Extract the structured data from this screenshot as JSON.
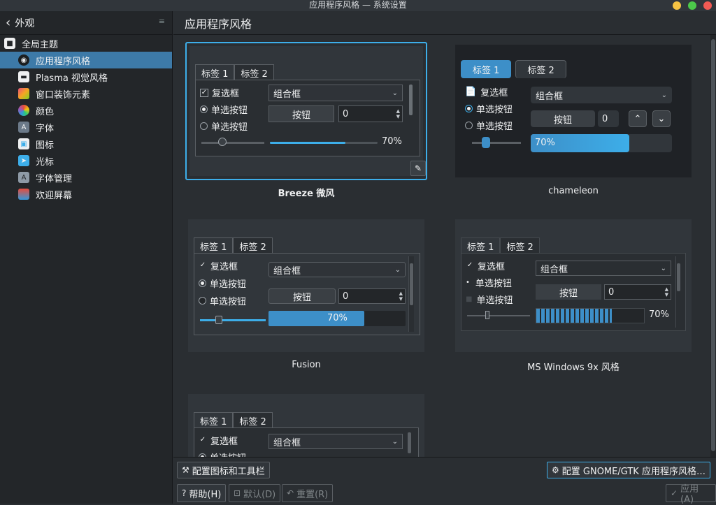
{
  "window": {
    "title": "应用程序风格 — 系统设置"
  },
  "sidebar": {
    "back_label": "外观",
    "items": [
      {
        "label": "全局主题",
        "icon": "global-theme-icon"
      },
      {
        "label": "应用程序风格",
        "icon": "app-style-icon"
      },
      {
        "label": "Plasma 视觉风格",
        "icon": "plasma-style-icon"
      },
      {
        "label": "窗口装饰元素",
        "icon": "window-decoration-icon"
      },
      {
        "label": "颜色",
        "icon": "colors-icon"
      },
      {
        "label": "字体",
        "icon": "fonts-icon"
      },
      {
        "label": "图标",
        "icon": "icons-icon"
      },
      {
        "label": "光标",
        "icon": "cursor-icon"
      },
      {
        "label": "字体管理",
        "icon": "font-manager-icon"
      },
      {
        "label": "欢迎屏幕",
        "icon": "splash-screen-icon"
      }
    ],
    "selected": 1
  },
  "page": {
    "title": "应用程序风格"
  },
  "styles": [
    {
      "name": "Breeze 微风",
      "tab1": "标签 1",
      "tab2": "标签 2",
      "checkbox": "复选框",
      "radio1": "单选按钮",
      "radio2": "单选按钮",
      "combo": "组合框",
      "button": "按钮",
      "spin": "0",
      "progress": "70%",
      "progress_value": 70
    },
    {
      "name": "chameleon",
      "tab1": "标签 1",
      "tab2": "标签 2",
      "checkbox": "复选框",
      "radio1": "单选按钮",
      "radio2": "单选按钮",
      "combo": "组合框",
      "button": "按钮",
      "spin": "0",
      "progress": "70%",
      "progress_value": 70
    },
    {
      "name": "Fusion",
      "tab1": "标签 1",
      "tab2": "标签 2",
      "checkbox": "复选框",
      "radio1": "单选按钮",
      "radio2": "单选按钮",
      "combo": "组合框",
      "button": "按钮",
      "spin": "0",
      "progress": "70%",
      "progress_value": 70
    },
    {
      "name": "MS Windows 9x 风格",
      "tab1": "标签 1",
      "tab2": "标签 2",
      "checkbox": "复选框",
      "radio1": "单选按钮",
      "radio2": "单选按钮",
      "combo": "组合框",
      "button": "按钮",
      "spin": "0",
      "progress": "70%",
      "progress_value": 70
    },
    {
      "tab1": "标签 1",
      "tab2": "标签 2",
      "checkbox": "复选框",
      "radio1": "单选按钮",
      "combo": "组合框"
    }
  ],
  "footer": {
    "configure_icons_toolbars": "配置图标和工具栏",
    "configure_gtk": "配置 GNOME/GTK 应用程序风格…",
    "help": "帮助(H)",
    "defaults": "默认(D)",
    "reset": "重置(R)",
    "apply": "应用(A)"
  },
  "colors": {
    "accent": "#3daee9",
    "selection": "#3d7aa8",
    "background": "#2a2e32",
    "sidebar": "#232629"
  }
}
